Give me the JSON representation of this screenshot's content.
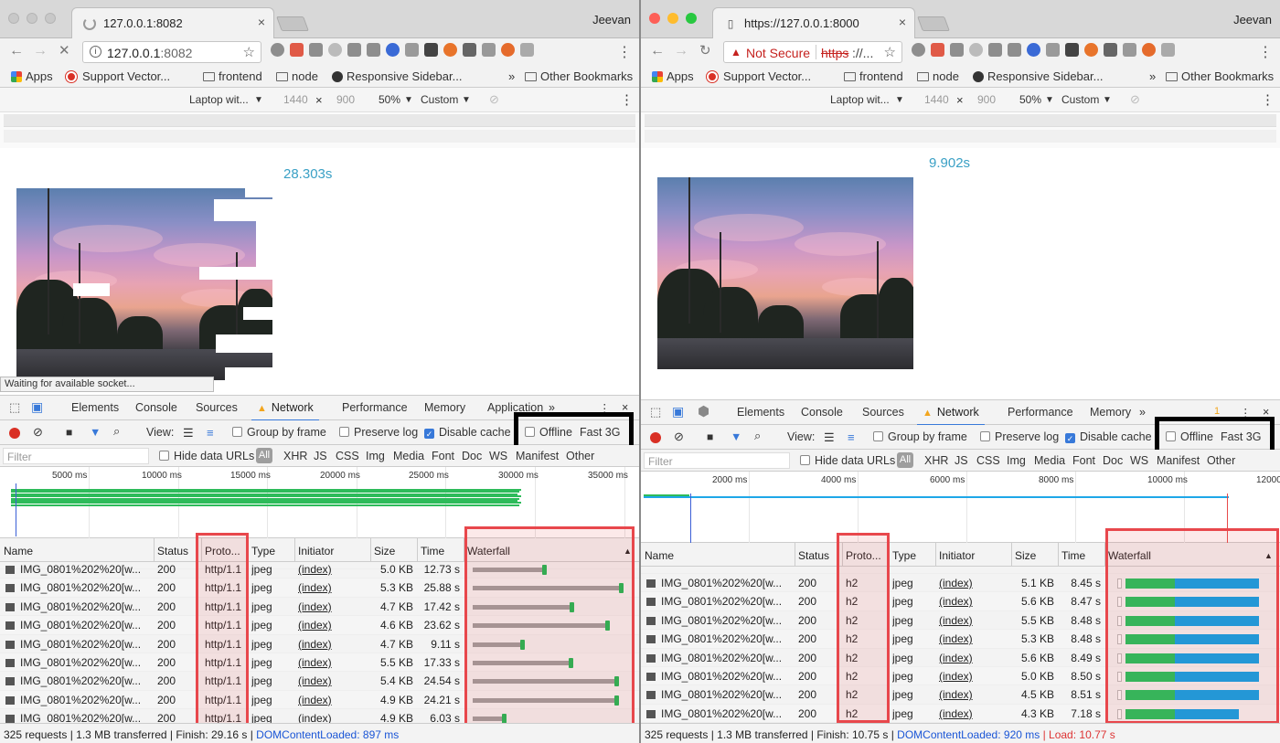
{
  "left": {
    "tab_title": "127.0.0.1:8082",
    "user": "Jeevan",
    "url_host": "127.0.0.1",
    "url_port": ":8082",
    "timer": "28.303s",
    "tooltip": "Waiting for available socket...",
    "devtools_tabs": [
      "Elements",
      "Console",
      "Sources",
      "Network",
      "Performance",
      "Memory",
      "Application"
    ],
    "overview_labels": [
      "5000 ms",
      "10000 ms",
      "15000 ms",
      "20000 ms",
      "25000 ms",
      "30000 ms",
      "35000 ms"
    ],
    "rows": [
      {
        "name": "IMG_0801%202%20[w...",
        "status": "200",
        "protocol": "http/1.1",
        "type": "jpeg",
        "initiator": "(index)",
        "size": "5.0 KB",
        "time": "12.73 s"
      },
      {
        "name": "IMG_0801%202%20[w...",
        "status": "200",
        "protocol": "http/1.1",
        "type": "jpeg",
        "initiator": "(index)",
        "size": "5.3 KB",
        "time": "25.88 s"
      },
      {
        "name": "IMG_0801%202%20[w...",
        "status": "200",
        "protocol": "http/1.1",
        "type": "jpeg",
        "initiator": "(index)",
        "size": "4.7 KB",
        "time": "17.42 s"
      },
      {
        "name": "IMG_0801%202%20[w...",
        "status": "200",
        "protocol": "http/1.1",
        "type": "jpeg",
        "initiator": "(index)",
        "size": "4.6 KB",
        "time": "23.62 s"
      },
      {
        "name": "IMG_0801%202%20[w...",
        "status": "200",
        "protocol": "http/1.1",
        "type": "jpeg",
        "initiator": "(index)",
        "size": "4.7 KB",
        "time": "9.11 s"
      },
      {
        "name": "IMG_0801%202%20[w...",
        "status": "200",
        "protocol": "http/1.1",
        "type": "jpeg",
        "initiator": "(index)",
        "size": "5.5 KB",
        "time": "17.33 s"
      },
      {
        "name": "IMG_0801%202%20[w...",
        "status": "200",
        "protocol": "http/1.1",
        "type": "jpeg",
        "initiator": "(index)",
        "size": "5.4 KB",
        "time": "24.54 s"
      },
      {
        "name": "IMG_0801%202%20[w...",
        "status": "200",
        "protocol": "http/1.1",
        "type": "jpeg",
        "initiator": "(index)",
        "size": "4.9 KB",
        "time": "24.21 s"
      },
      {
        "name": "IMG_0801%202%20[w...",
        "status": "200",
        "protocol": "http/1.1",
        "type": "jpeg",
        "initiator": "(index)",
        "size": "4.9 KB",
        "time": "6.03 s"
      }
    ],
    "waterfall_fraction": [
      0.47,
      0.97,
      0.65,
      0.88,
      0.33,
      0.64,
      0.94,
      0.94,
      0.21
    ],
    "footer_summary": "325 requests | 1.3 MB transferred | Finish: 29.16 s | ",
    "footer_dcl": "DOMContentLoaded: 897 ms",
    "footer_load": ""
  },
  "right": {
    "tab_title": "https://127.0.0.1:8000",
    "user": "Jeevan",
    "not_secure": "Not Secure",
    "https_text": "https",
    "url_rest": "://...",
    "timer": "9.902s",
    "warn_count": "1",
    "devtools_tabs": [
      "Elements",
      "Console",
      "Sources",
      "Network",
      "Performance",
      "Memory"
    ],
    "overview_labels": [
      "2000 ms",
      "4000 ms",
      "6000 ms",
      "8000 ms",
      "10000 ms",
      "12000"
    ],
    "rows": [
      {
        "name": "IMG_0801%202%20[w...",
        "status": "200",
        "protocol": "h2",
        "type": "jpeg",
        "initiator": "(index)",
        "size": "5.1 KB",
        "time": "8.45 s"
      },
      {
        "name": "IMG_0801%202%20[w...",
        "status": "200",
        "protocol": "h2",
        "type": "jpeg",
        "initiator": "(index)",
        "size": "5.6 KB",
        "time": "8.47 s"
      },
      {
        "name": "IMG_0801%202%20[w...",
        "status": "200",
        "protocol": "h2",
        "type": "jpeg",
        "initiator": "(index)",
        "size": "5.5 KB",
        "time": "8.48 s"
      },
      {
        "name": "IMG_0801%202%20[w...",
        "status": "200",
        "protocol": "h2",
        "type": "jpeg",
        "initiator": "(index)",
        "size": "5.3 KB",
        "time": "8.48 s"
      },
      {
        "name": "IMG_0801%202%20[w...",
        "status": "200",
        "protocol": "h2",
        "type": "jpeg",
        "initiator": "(index)",
        "size": "5.6 KB",
        "time": "8.49 s"
      },
      {
        "name": "IMG_0801%202%20[w...",
        "status": "200",
        "protocol": "h2",
        "type": "jpeg",
        "initiator": "(index)",
        "size": "5.0 KB",
        "time": "8.50 s"
      },
      {
        "name": "IMG_0801%202%20[w...",
        "status": "200",
        "protocol": "h2",
        "type": "jpeg",
        "initiator": "(index)",
        "size": "4.5 KB",
        "time": "8.51 s"
      },
      {
        "name": "IMG_0801%202%20[w...",
        "status": "200",
        "protocol": "h2",
        "type": "jpeg",
        "initiator": "(index)",
        "size": "4.3 KB",
        "time": "7.18 s"
      }
    ],
    "footer_summary": "325 requests | 1.3 MB transferred | Finish: 10.75 s | ",
    "footer_dcl": "DOMContentLoaded: 920 ms",
    "footer_load": " | Load: 10.77 s"
  },
  "shared": {
    "bookmarks": [
      "Apps",
      "Support Vector...",
      "frontend",
      "node",
      "Responsive Sidebar...",
      "»",
      "Other Bookmarks"
    ],
    "device": "Laptop wit...",
    "width": "1440",
    "height": "900",
    "x_sep": "×",
    "zoom": "50%",
    "throttle_preset": "Custom",
    "view_label": "View:",
    "group_by_frame": "Group by frame",
    "preserve_log": "Preserve log",
    "disable_cache": "Disable cache",
    "offline": "Offline",
    "throttle": "Fast 3G",
    "filter_placeholder": "Filter",
    "hide_data_urls": "Hide data URLs",
    "filter_types": [
      "All",
      "XHR",
      "JS",
      "CSS",
      "Img",
      "Media",
      "Font",
      "Doc",
      "WS",
      "Manifest",
      "Other"
    ],
    "columns": [
      "Name",
      "Status",
      "Proto...",
      "Type",
      "Initiator",
      "Size",
      "Time",
      "Waterfall"
    ],
    "more_tabs": "»"
  },
  "colors": {
    "accent": "#3879d9",
    "timer": "#3aa0c5",
    "highlight": "#e8474c",
    "record": "#d93025"
  }
}
